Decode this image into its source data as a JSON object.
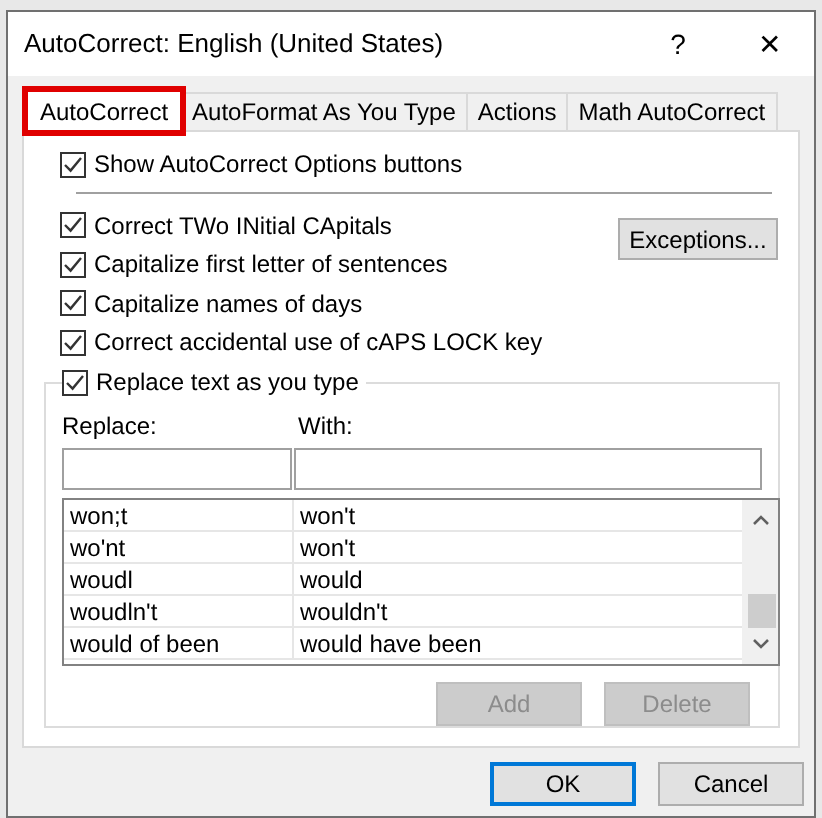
{
  "window": {
    "title": "AutoCorrect: English (United States)",
    "help": "?",
    "close": "✕"
  },
  "tabs": [
    {
      "label": "AutoCorrect",
      "selected": true,
      "highlighted": true
    },
    {
      "label": "AutoFormat As You Type",
      "selected": false,
      "highlighted": false
    },
    {
      "label": "Actions",
      "selected": false,
      "highlighted": false
    },
    {
      "label": "Math AutoCorrect",
      "selected": false,
      "highlighted": false
    }
  ],
  "show_options": {
    "label": "Show AutoCorrect Options buttons",
    "checked": true
  },
  "options": [
    {
      "label": "Correct TWo INitial CApitals",
      "checked": true
    },
    {
      "label": "Capitalize first letter of sentences",
      "checked": true
    },
    {
      "label": "Capitalize names of days",
      "checked": true
    },
    {
      "label": "Correct accidental use of cAPS LOCK key",
      "checked": true
    }
  ],
  "exceptions_button": "Exceptions...",
  "replace_group": {
    "label": "Replace text as you type",
    "checked": true,
    "replace_label": "Replace:",
    "with_label": "With:",
    "rows": [
      {
        "replace": "won;t",
        "with": "won't"
      },
      {
        "replace": "wo'nt",
        "with": "won't"
      },
      {
        "replace": "woudl",
        "with": "would"
      },
      {
        "replace": "woudln't",
        "with": "wouldn't"
      },
      {
        "replace": "would of been",
        "with": "would have been"
      }
    ],
    "buttons": [
      {
        "label": "Add",
        "disabled": true
      },
      {
        "label": "Delete",
        "disabled": true
      }
    ]
  },
  "footer_buttons": [
    {
      "label": "OK",
      "default": true
    },
    {
      "label": "Cancel",
      "default": false
    }
  ]
}
